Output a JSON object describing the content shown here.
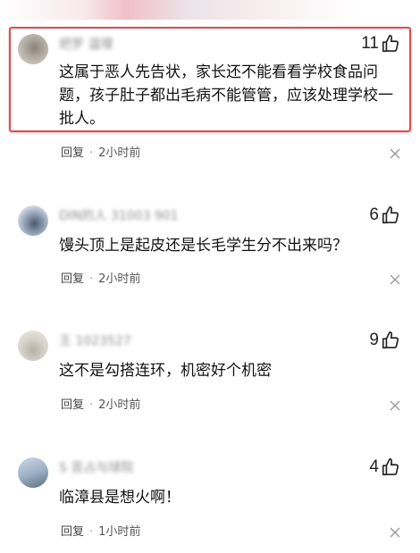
{
  "comments": [
    {
      "username": "把罗 温理",
      "likes": "11",
      "content": "这属于恶人先告状，家长还不能看看学校食品问题，孩子肚子都出毛病不能管管，应该处理学校一批人。",
      "reply_label": "回复",
      "time": "2小时前"
    },
    {
      "username": "DIN的人 31003 901",
      "likes": "6",
      "content": "馒头顶上是起皮还是长毛学生分不出来吗？",
      "reply_label": "回复",
      "time": "2小时前"
    },
    {
      "username": "王 1023527",
      "likes": "9",
      "content": "这不是勾搭连环，机密好个机密",
      "reply_label": "回复",
      "time": "2小时前"
    },
    {
      "username": "S 苦占与球院",
      "likes": "4",
      "content": "临漳县是想火啊！",
      "reply_label": "回复",
      "time": "1小时前"
    }
  ],
  "meta_separator": "·",
  "colors": {
    "highlight_border": "#e04a4f",
    "text_primary": "#111111",
    "text_secondary": "#555555"
  },
  "icons": {
    "like": "thumbs-up-icon",
    "dismiss": "close-icon"
  }
}
